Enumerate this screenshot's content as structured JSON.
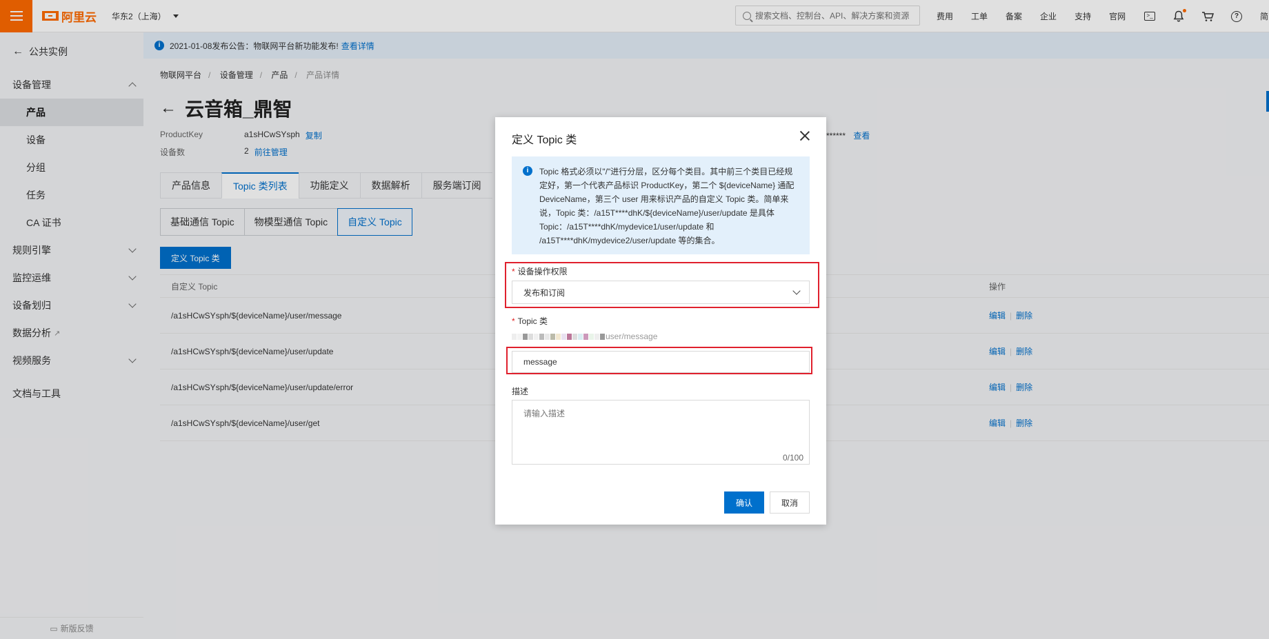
{
  "topbar": {
    "logo_text": "阿里云",
    "region": "华东2（上海）",
    "search_placeholder": "搜索文档、控制台、API、解决方案和资源",
    "nav": [
      "费用",
      "工单",
      "备案",
      "企业",
      "支持",
      "官网"
    ],
    "lang": "简"
  },
  "sidebar": {
    "back": "公共实例",
    "group_device": "设备管理",
    "items": [
      "产品",
      "设备",
      "分组",
      "任务",
      "CA 证书"
    ],
    "groups": [
      "规则引擎",
      "监控运维",
      "设备划归",
      "数据分析",
      "视频服务"
    ],
    "docs": "文档与工具",
    "feedback": "新版反馈"
  },
  "notice": {
    "text": "2021-01-08发布公告：物联网平台新功能发布!",
    "link": "查看详情"
  },
  "breadcrumb": [
    "物联网平台",
    "设备管理",
    "产品",
    "产品详情"
  ],
  "product": {
    "title": "云音箱_鼎智",
    "productkey_label": "ProductKey",
    "productkey_value": "a1sHCwSYsph",
    "copy": "复制",
    "device_count_label": "设备数",
    "device_count_value": "2",
    "manage_link": "前往管理",
    "secret_mask": "******",
    "view_link": "查看"
  },
  "tabs": [
    "产品信息",
    "Topic 类列表",
    "功能定义",
    "数据解析",
    "服务端订阅"
  ],
  "subtabs": [
    "基础通信 Topic",
    "物模型通信 Topic",
    "自定义 Topic"
  ],
  "define_button": "定义 Topic 类",
  "table": {
    "col_topic": "自定义 Topic",
    "col_ops": "操作",
    "rows": [
      "/a1sHCwSYsph/${deviceName}/user/message",
      "/a1sHCwSYsph/${deviceName}/user/update",
      "/a1sHCwSYsph/${deviceName}/user/update/error",
      "/a1sHCwSYsph/${deviceName}/user/get"
    ],
    "edit": "编辑",
    "delete": "删除"
  },
  "modal": {
    "title": "定义 Topic 类",
    "info": "Topic 格式必须以\"/\"进行分层，区分每个类目。其中前三个类目已经规定好，第一个代表产品标识 ProductKey，第二个 ${deviceName} 通配 DeviceName，第三个 user 用来标识产品的自定义 Topic 类。简单来说，Topic 类：/a15T****dhK/${deviceName}/user/update 是具体 Topic：/a15T****dhK/mydevice1/user/update 和 /a15T****dhK/mydevice2/user/update 等的集合。",
    "perm_label": "设备操作权限",
    "perm_value": "发布和订阅",
    "topic_label": "Topic 类",
    "topic_prefix_suffix": "user/message",
    "topic_value": "message",
    "desc_label": "描述",
    "desc_placeholder": "请输入描述",
    "counter": "0/100",
    "ok": "确认",
    "cancel": "取消"
  },
  "colors": {
    "accent": "#0070cc",
    "brand": "#ff6a00",
    "highlight": "#e0202d"
  }
}
